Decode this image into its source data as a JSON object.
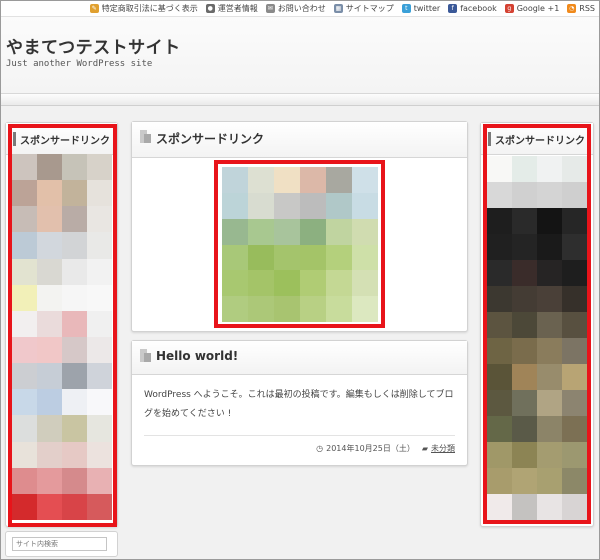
{
  "topbar": {
    "links": [
      {
        "label": "特定商取引法に基づく表示",
        "icon": "pencil-icon",
        "color": "#e0a030"
      },
      {
        "label": "運営者情報",
        "icon": "user-icon",
        "color": "#6a6a6a"
      },
      {
        "label": "お問い合わせ",
        "icon": "mail-icon",
        "color": "#8a8a8a"
      },
      {
        "label": "サイトマップ",
        "icon": "sitemap-icon",
        "color": "#7a8ea8"
      },
      {
        "label": "twitter",
        "icon": "twitter-icon",
        "color": "#3aa0d8"
      },
      {
        "label": "facebook",
        "icon": "facebook-icon",
        "color": "#3b5998"
      },
      {
        "label": "Google +1",
        "icon": "google-plus-icon",
        "color": "#d44132"
      },
      {
        "label": "RSS",
        "icon": "rss-icon",
        "color": "#f08a1c"
      }
    ]
  },
  "header": {
    "site_title": "やまてつテストサイト",
    "site_description": "Just another WordPress site"
  },
  "left_sidebar": {
    "widget_title": "スポンサードリンク",
    "search_placeholder": "サイト内検索"
  },
  "main": {
    "ad_widget_title": "スポンサードリンク",
    "post": {
      "title": "Hello world!",
      "body": "WordPress へようこそ。これは最初の投稿です。編集もしくは削除してブログを始めてください !",
      "date": "2014年10月25日（土）",
      "category": "未分類"
    }
  },
  "right_sidebar": {
    "widget_title": "スポンサードリンク"
  },
  "colors": {
    "ad_outline": "#e8141a",
    "left_ad_palette": [
      "#cdc4be",
      "#a8998e",
      "#c6c3b8",
      "#d7d2c9",
      "#bca397",
      "#e2c0a9",
      "#c2b39b",
      "#e6e2dc",
      "#c7bcb6",
      "#e2c0ad",
      "#b9aca6",
      "#e9e6e2",
      "#bccad6",
      "#d2d7dd",
      "#d2d4d6",
      "#e9e9e7",
      "#e2e3d0",
      "#d9d8d2",
      "#e9e9e9",
      "#f2f2f2",
      "#f2f0b8",
      "#f3f3f1",
      "#f6f6f6",
      "#f8f8f8",
      "#f2efef",
      "#eadbdb",
      "#e9b8ba",
      "#f0f0f0",
      "#f0c8cb",
      "#f1c7c7",
      "#d6c8c8",
      "#ece8e8",
      "#ccced2",
      "#c6cdd6",
      "#9da3ab",
      "#cfd3da",
      "#c8d8e8",
      "#bccde2",
      "#eef0f4",
      "#f8f8fa",
      "#dcdedd",
      "#d0cdbd",
      "#c9c5a2",
      "#e6e6df",
      "#e8e2da",
      "#e3cfca",
      "#e6c9c5",
      "#ece2de",
      "#de8c8e",
      "#e49a9c",
      "#d58a8c",
      "#e8b1b3",
      "#d42a2c",
      "#e44e52",
      "#d84448",
      "#d65a5c"
    ],
    "center_ad_palette": [
      "#c0d4da",
      "#dde0d2",
      "#f0e0c4",
      "#dcb8a8",
      "#a8a8a0",
      "#cfe0e8",
      "#bcd4d8",
      "#d8dcd0",
      "#c8c8c6",
      "#bcbcbc",
      "#b0c8c8",
      "#c8dce4",
      "#98b890",
      "#a8c890",
      "#a8c49c",
      "#8cb080",
      "#c0d4a0",
      "#d0dcb0",
      "#a8c878",
      "#98bc5c",
      "#a4c46c",
      "#a4c468",
      "#b4d07c",
      "#cee0a8",
      "#a8c870",
      "#a4c468",
      "#9cc05c",
      "#b0cc74",
      "#c4d894",
      "#d4e0b4",
      "#b0cc80",
      "#acc878",
      "#a8c470",
      "#b8d084",
      "#c8dc9c",
      "#dce8c0"
    ],
    "right_ad_palette": [
      "#f8f8f6",
      "#e4ece8",
      "#f0f2f2",
      "#e6eae8",
      "#d8d8d8",
      "#d0d0d0",
      "#d4d4d4",
      "#cfcfcf",
      "#1e1e1e",
      "#2a2a2a",
      "#141414",
      "#262626",
      "#202020",
      "#242424",
      "#1a1a1a",
      "#2e2e2e",
      "#2a2a2a",
      "#3a2c2a",
      "#262424",
      "#1e1e1e",
      "#3c3830",
      "#443c34",
      "#4a4038",
      "#36302a",
      "#5c5440",
      "#4c4838",
      "#6a6250",
      "#585040",
      "#6e6444",
      "#7a6c4c",
      "#8a7c5c",
      "#7c7464",
      "#5a5438",
      "#a08458",
      "#988c6c",
      "#b8a474",
      "#5c5840",
      "#70705c",
      "#b0a484",
      "#8c8470",
      "#646848",
      "#5a5a48",
      "#8c8468",
      "#7c7054",
      "#a09868",
      "#8c8454",
      "#a49c70",
      "#9c9870",
      "#a89c6c",
      "#b0a474",
      "#a8a070",
      "#8c8868",
      "#f0eaea",
      "#c4c2c0",
      "#e8e4e4",
      "#d8d4d4"
    ]
  }
}
